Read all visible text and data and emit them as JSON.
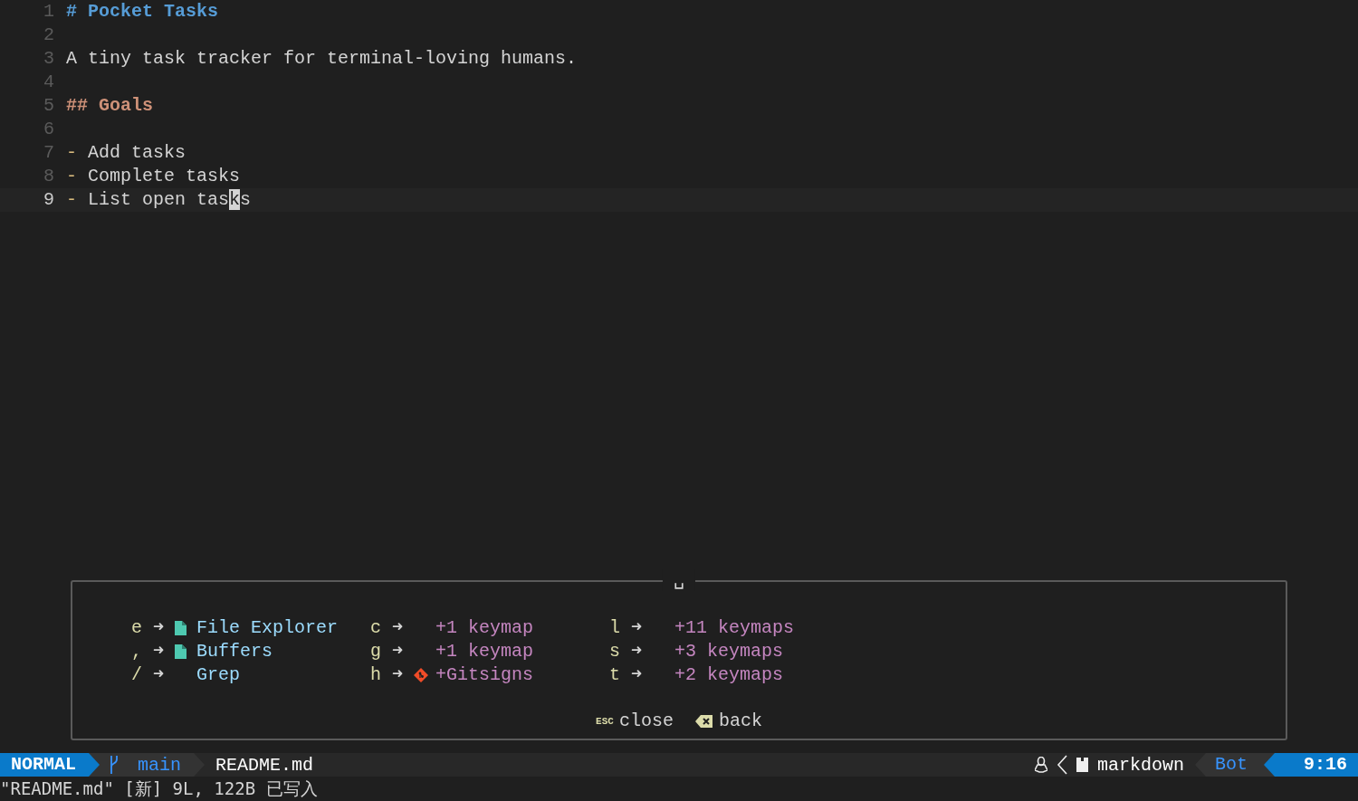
{
  "editor": {
    "lines": [
      {
        "number": "1",
        "kind": "h1",
        "marker": "#",
        "text": "Pocket Tasks",
        "current": false
      },
      {
        "number": "2",
        "kind": "blank",
        "current": false
      },
      {
        "number": "3",
        "kind": "text",
        "text": "A tiny task tracker for terminal-loving humans.",
        "current": false
      },
      {
        "number": "4",
        "kind": "blank",
        "current": false
      },
      {
        "number": "5",
        "kind": "h2",
        "marker": "##",
        "text": "Goals",
        "current": false
      },
      {
        "number": "6",
        "kind": "blank",
        "current": false
      },
      {
        "number": "7",
        "kind": "item",
        "marker": "-",
        "text": "Add tasks",
        "current": false
      },
      {
        "number": "8",
        "kind": "item",
        "marker": "-",
        "text": "Complete tasks",
        "current": false
      },
      {
        "number": "9",
        "kind": "item",
        "marker": "-",
        "text": "List open tas",
        "cursor_char": "k",
        "text_after": "s",
        "current": true
      }
    ]
  },
  "keymap_popup": {
    "title": "␣",
    "columns": [
      [
        {
          "key": "e",
          "arrow": "➜",
          "label": "File Explorer",
          "kind": "file"
        },
        {
          "key": ",",
          "arrow": "➜",
          "label": "Buffers",
          "kind": "file"
        },
        {
          "key": "/",
          "arrow": "➜",
          "label": "Grep",
          "kind": "action"
        }
      ],
      [
        {
          "key": "c",
          "arrow": "➜",
          "label": "+1 keymap",
          "kind": "group"
        },
        {
          "key": "g",
          "arrow": "➜",
          "label": "+1 keymap",
          "kind": "group"
        },
        {
          "key": "h",
          "arrow": "➜",
          "label": "+Gitsigns",
          "kind": "gitsigns"
        }
      ],
      [
        {
          "key": "l",
          "arrow": "➜",
          "label": "+11 keymaps",
          "kind": "group"
        },
        {
          "key": "s",
          "arrow": "➜",
          "label": "+3 keymaps",
          "kind": "group"
        },
        {
          "key": "t",
          "arrow": "➜",
          "label": "+2 keymaps",
          "kind": "group"
        }
      ]
    ],
    "footer": [
      {
        "kind": "esc",
        "key": "ESC",
        "label": "close"
      },
      {
        "kind": "backspace",
        "label": "back"
      }
    ]
  },
  "status_bar": {
    "mode": "NORMAL",
    "branch": "main",
    "filename": "README.md",
    "filetype": "markdown",
    "position": "Bot",
    "cursor": "9:16"
  },
  "message": "\"README.md\" [新] 9L, 122B 已写入"
}
